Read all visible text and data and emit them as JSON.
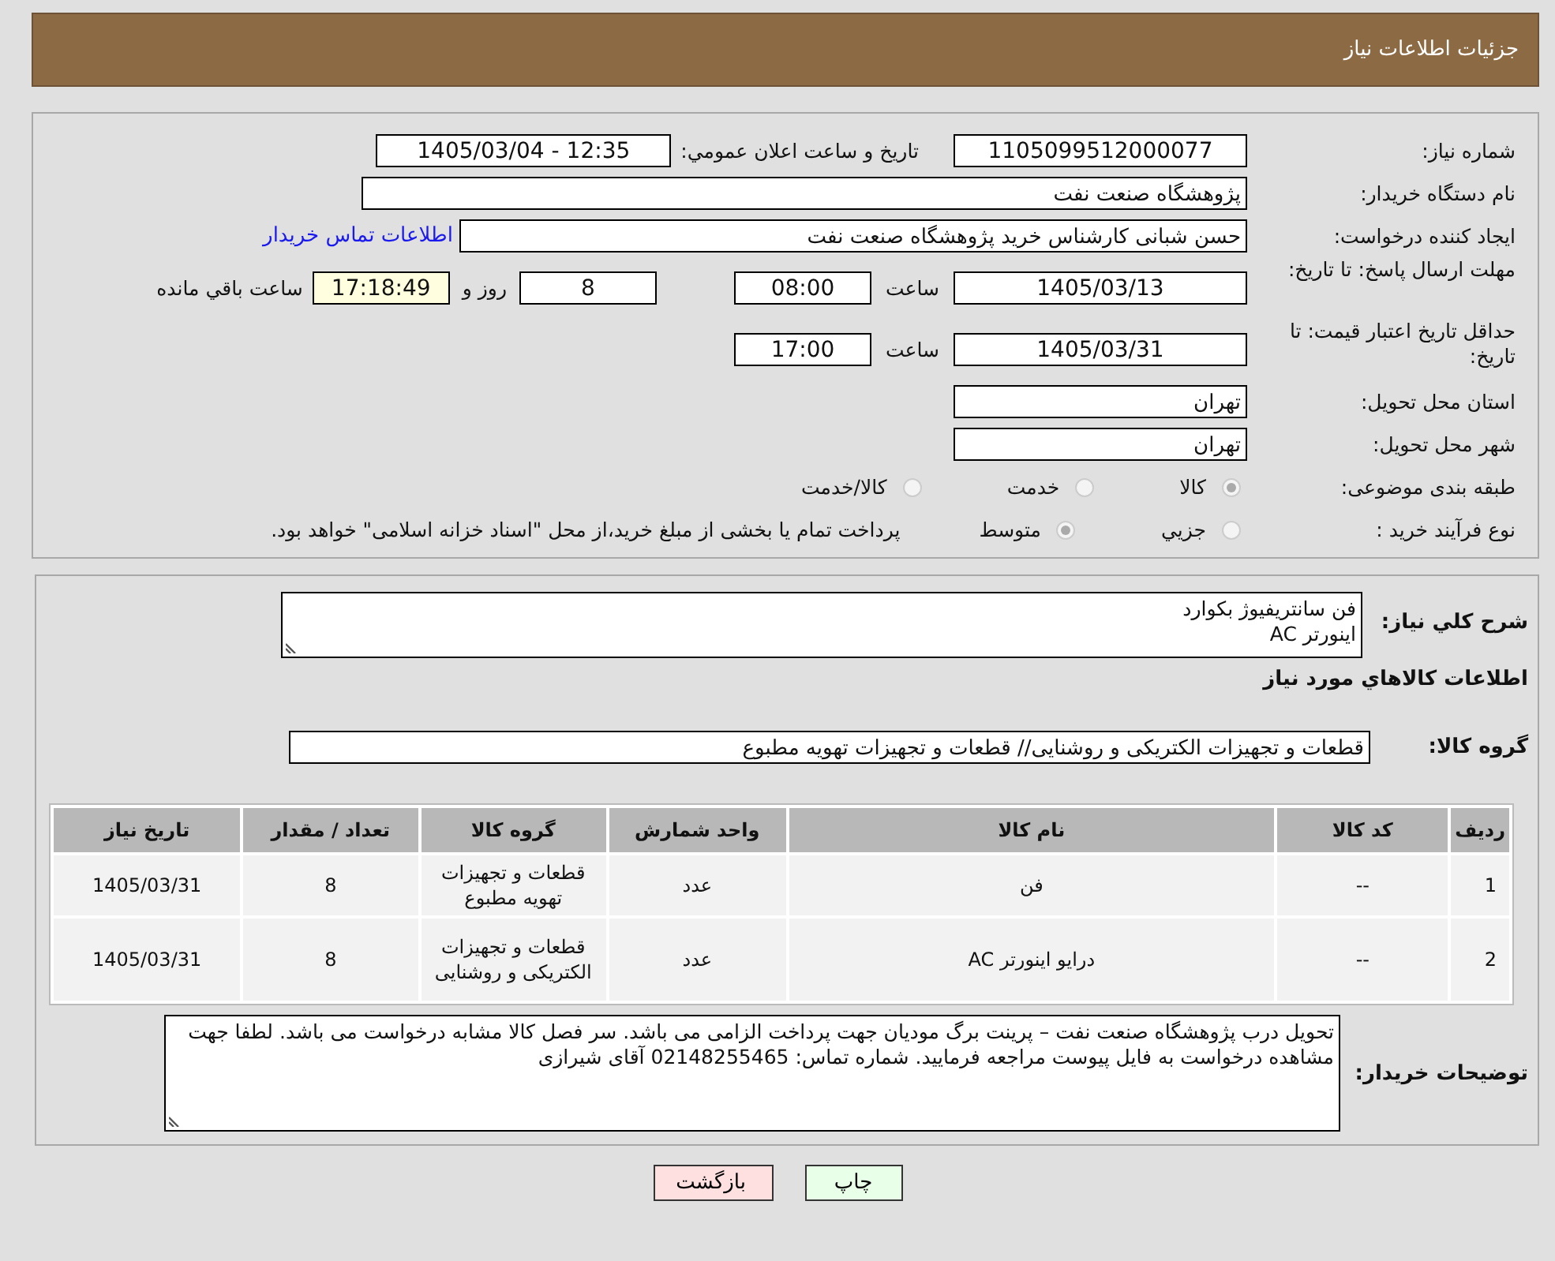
{
  "header": {
    "title": "جزئیات اطلاعات نیاز"
  },
  "need_number": {
    "label": "شماره نیاز:",
    "value": "1105099512000077"
  },
  "announce": {
    "label": "تاریخ و ساعت اعلان عمومي:",
    "value": "1405/03/04 - 12:35"
  },
  "buyer_org": {
    "label": "نام دستگاه خریدار:",
    "value": "پژوهشگاه صنعت نفت"
  },
  "requester": {
    "label": "ایجاد کننده درخواست:",
    "value": "حسن شبانی کارشناس خرید پژوهشگاه صنعت نفت",
    "link": "اطلاعات تماس خریدار"
  },
  "reply_deadline": {
    "label": "مهلت ارسال پاسخ: تا تاریخ:",
    "date": "1405/03/13",
    "time_label": "ساعت",
    "time": "08:00",
    "days": "8",
    "days_label": "روز و",
    "remaining": "17:18:49",
    "remaining_label": "ساعت باقي مانده"
  },
  "price_validity": {
    "label": "حداقل تاریخ اعتبار قیمت: تا تاریخ:",
    "date": "1405/03/31",
    "time_label": "ساعت",
    "time": "17:00"
  },
  "province": {
    "label": "استان محل تحویل:",
    "value": "تهران"
  },
  "city": {
    "label": "شهر محل تحویل:",
    "value": "تهران"
  },
  "category": {
    "label": "طبقه بندی موضوعی:",
    "options": [
      {
        "label": "کالا",
        "selected": true
      },
      {
        "label": "خدمت",
        "selected": false
      },
      {
        "label": "کالا/خدمت",
        "selected": false
      }
    ]
  },
  "process": {
    "label": "نوع فرآیند خرید :",
    "options": [
      {
        "label": "جزيي",
        "selected": false
      },
      {
        "label": "متوسط",
        "selected": true
      }
    ],
    "note": "پرداخت تمام یا بخشی از مبلغ خرید،از محل \"اسناد خزانه اسلامی\" خواهد بود."
  },
  "description": {
    "label": "شرح کلي نیاز:",
    "lines": [
      "فن سانتریفیوژ بکوارد",
      "اینورتر AC"
    ]
  },
  "goods_title": "اطلاعات کالاهاي مورد نیاز",
  "goods_group": {
    "label": "گروه کالا:",
    "value": "قطعات و تجهیزات الکتریکی و روشنایی//  قطعات و تجهیزات تهویه مطبوع"
  },
  "table": {
    "columns": [
      "ردیف",
      "کد کالا",
      "نام کالا",
      "واحد شمارش",
      "گروه کالا",
      "تعداد / مقدار",
      "تاریخ نیاز"
    ],
    "rows": [
      [
        "1",
        "--",
        "فن",
        "عدد",
        "قطعات و تجهیزات تهویه مطبوع",
        "8",
        "1405/03/31"
      ],
      [
        "2",
        "--",
        "درایو اینورتر AC",
        "عدد",
        "قطعات و تجهیزات الکتریکی و روشنایی",
        "8",
        "1405/03/31"
      ]
    ]
  },
  "buyer_notes": {
    "label": "توضیحات خریدار:",
    "text": "تحویل درب پژوهشگاه صنعت نفت – پرینت برگ مودیان جهت پرداخت الزامی می باشد. سر فصل کالا مشابه درخواست می باشد. لطفا جهت مشاهده درخواست به فایل پیوست مراجعه فرمایید. شماره تماس: 02148255465 آقای شیرازی"
  },
  "buttons": [
    {
      "label": "چاپ",
      "kind": "print"
    },
    {
      "label": "بازگشت",
      "kind": "back"
    }
  ]
}
